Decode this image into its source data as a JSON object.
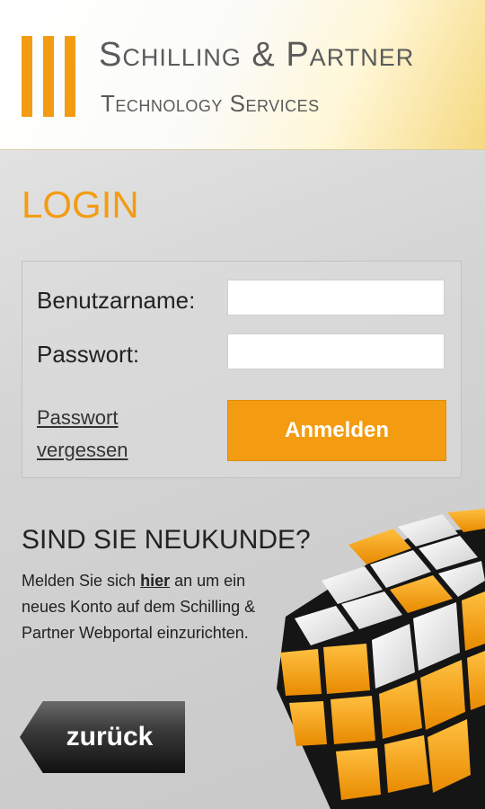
{
  "header": {
    "company_name": "Schilling & Partner",
    "company_tagline": "Technology Services"
  },
  "login": {
    "title": "LOGIN",
    "username_label": "Benutzarname:",
    "username_value": "",
    "password_label": "Passwort:",
    "password_value": "",
    "forgot_link_line1": "Passwort",
    "forgot_link_line2": "vergessen",
    "submit_label": "Anmelden"
  },
  "new_customer": {
    "title": "SIND SIE NEUKUNDE?",
    "text_before": "Melden Sie sich ",
    "link_label": "hier",
    "text_after": " an um ein neues Konto auf dem Schilling & Partner Webportal einzurichten."
  },
  "back_button": {
    "label": "zurück"
  },
  "colors": {
    "accent": "#f39c12",
    "text": "#222222"
  },
  "icons": {
    "cube": "rubiks-cube-icon"
  }
}
